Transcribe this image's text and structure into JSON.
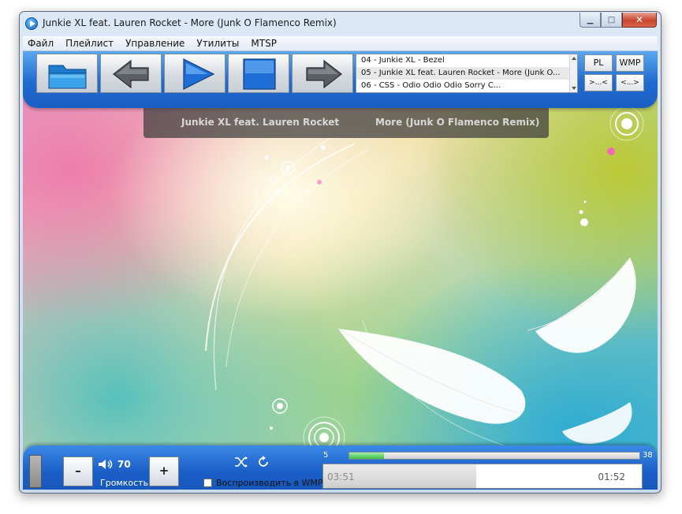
{
  "window": {
    "title": "Junkie XL feat. Lauren Rocket - More (Junk O Flamenco Remix)"
  },
  "menu": [
    "Файл",
    "Плейлист",
    "Управление",
    "Утилиты",
    "MTSP"
  ],
  "toolbar": {
    "buttons": [
      "folder-icon",
      "previous-arrow-icon",
      "play-icon",
      "stop-icon",
      "next-arrow-icon"
    ]
  },
  "playlist": {
    "items": [
      "04 - Junkie XL - Bezel",
      "05 - Junkie XL feat. Lauren Rocket - More (Junk O...",
      "06 - CSS - Odio Odio Odio Sorry C..."
    ],
    "selected_index": 1
  },
  "side_buttons": {
    "pl": "PL",
    "wmp": "WMP",
    "collapse": ">...<",
    "expand": "<...>"
  },
  "now_playing": {
    "artist": "Junkie XL feat. Lauren Rocket",
    "title": "More (Junk O Flamenco Remix)"
  },
  "controls": {
    "volume_value": "70",
    "volume_label": "Громкость",
    "minus": "–",
    "plus": "+",
    "play_in_wmp_label": "Воспроизводить в WMP",
    "play_in_wmp_checked": false
  },
  "position": {
    "start": "5",
    "end": "38",
    "progress_fraction": 0.12
  },
  "time": {
    "elapsed": "03:51",
    "total": "01:52",
    "progress_fraction": 0.48
  },
  "colors": {
    "accent_blue": "#1f6ad0",
    "progress_green": "#3cbf47"
  }
}
